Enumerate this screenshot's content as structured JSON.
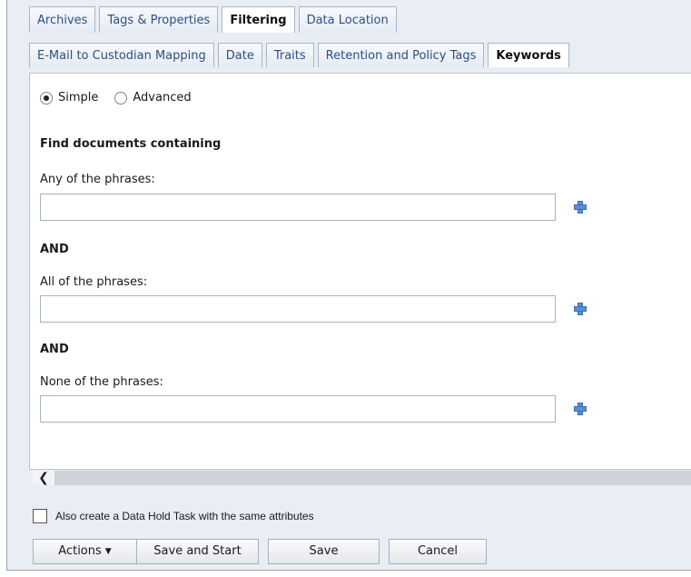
{
  "tabs_row1": [
    {
      "label": "Archives",
      "active": false
    },
    {
      "label": "Tags & Properties",
      "active": false
    },
    {
      "label": "Filtering",
      "active": true
    },
    {
      "label": "Data Location",
      "active": false
    }
  ],
  "tabs_row2": [
    {
      "label": "E-Mail to Custodian Mapping",
      "active": false
    },
    {
      "label": "Date",
      "active": false
    },
    {
      "label": "Traits",
      "active": false
    },
    {
      "label": "Retention and Policy Tags",
      "active": false
    },
    {
      "label": "Keywords",
      "active": true
    }
  ],
  "mode": {
    "simple_label": "Simple",
    "advanced_label": "Advanced",
    "selected": "Simple"
  },
  "form": {
    "section_title": "Find documents containing",
    "any_label": "Any of the phrases:",
    "any_value": "",
    "and1": "AND",
    "all_label": "All of the phrases:",
    "all_value": "",
    "and2": "AND",
    "none_label": "None of the phrases:",
    "none_value": ""
  },
  "scroll": {
    "left_arrow": "❮"
  },
  "footer": {
    "hold_task_label": "Also create a Data Hold Task with the same attributes",
    "hold_task_checked": false,
    "actions_label": "Actions",
    "actions_caret": "▼",
    "save_start_label": "Save and Start",
    "save_label": "Save",
    "cancel_label": "Cancel"
  },
  "icons": {
    "plus": "plus-icon",
    "accent": "#5b8fd1"
  }
}
